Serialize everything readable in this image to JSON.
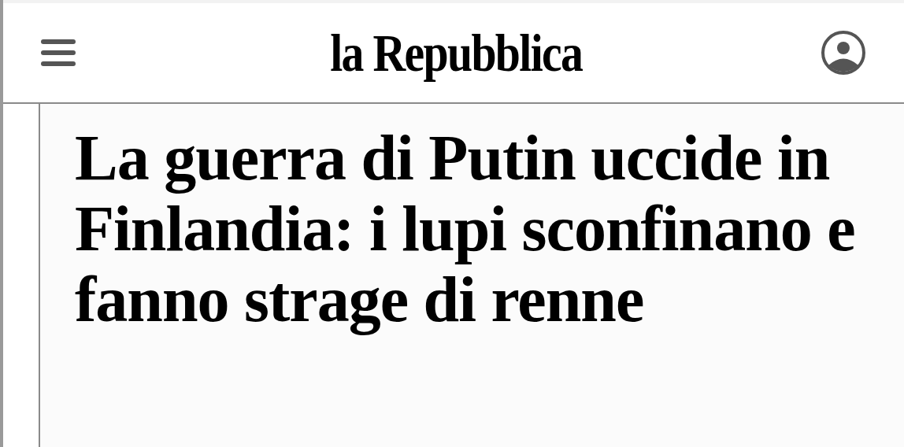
{
  "header": {
    "logo": "la Repubblica"
  },
  "article": {
    "headline": "La guerra di Putin uccide in Finlandia: i lupi sconfinano e fanno strage di renne"
  }
}
